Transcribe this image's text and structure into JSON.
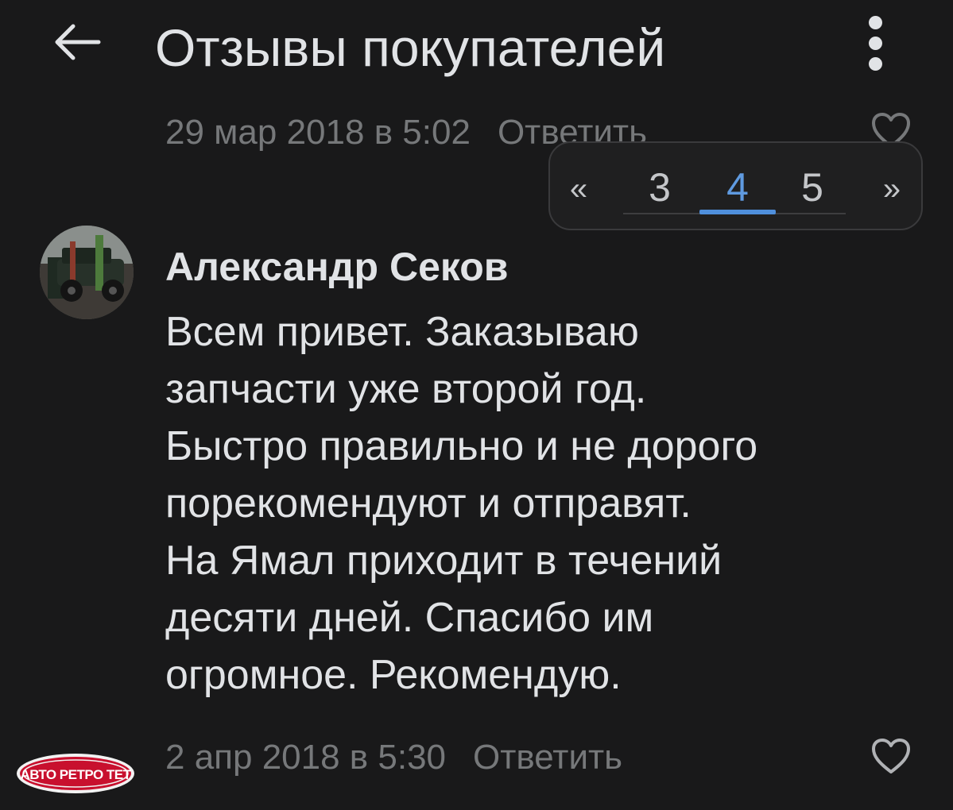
{
  "header": {
    "title": "Отзывы покупателей",
    "back_icon": "arrow-left-icon",
    "more_icon": "more-vertical-icon"
  },
  "previous_review": {
    "date": "29 мар 2018 в 5:02",
    "reply_label": "Ответить"
  },
  "pagination": {
    "prev_label": "«",
    "next_label": "»",
    "pages": [
      "3",
      "4",
      "5"
    ],
    "current_page": "4"
  },
  "review": {
    "author": "Александр Секов",
    "text_lines": [
      "Всем привет. Заказываю",
      "запчасти уже второй год.",
      "Быстро правильно и не дорого",
      "порекомендуют и отправят.",
      "На Ямал приходит в течений",
      "десяти дней. Спасибо им",
      "огромное. Рекомендую."
    ],
    "date": "2 апр 2018 в 5:30",
    "reply_label": "Ответить",
    "like_icon": "heart-outline-icon"
  },
  "watermark": {
    "text": "АВТО РЕТРО ТЕТ"
  },
  "colors": {
    "background": "#19191a",
    "text_primary": "#e1e3e6",
    "text_secondary": "#76787a",
    "accent": "#4f8fdc"
  }
}
